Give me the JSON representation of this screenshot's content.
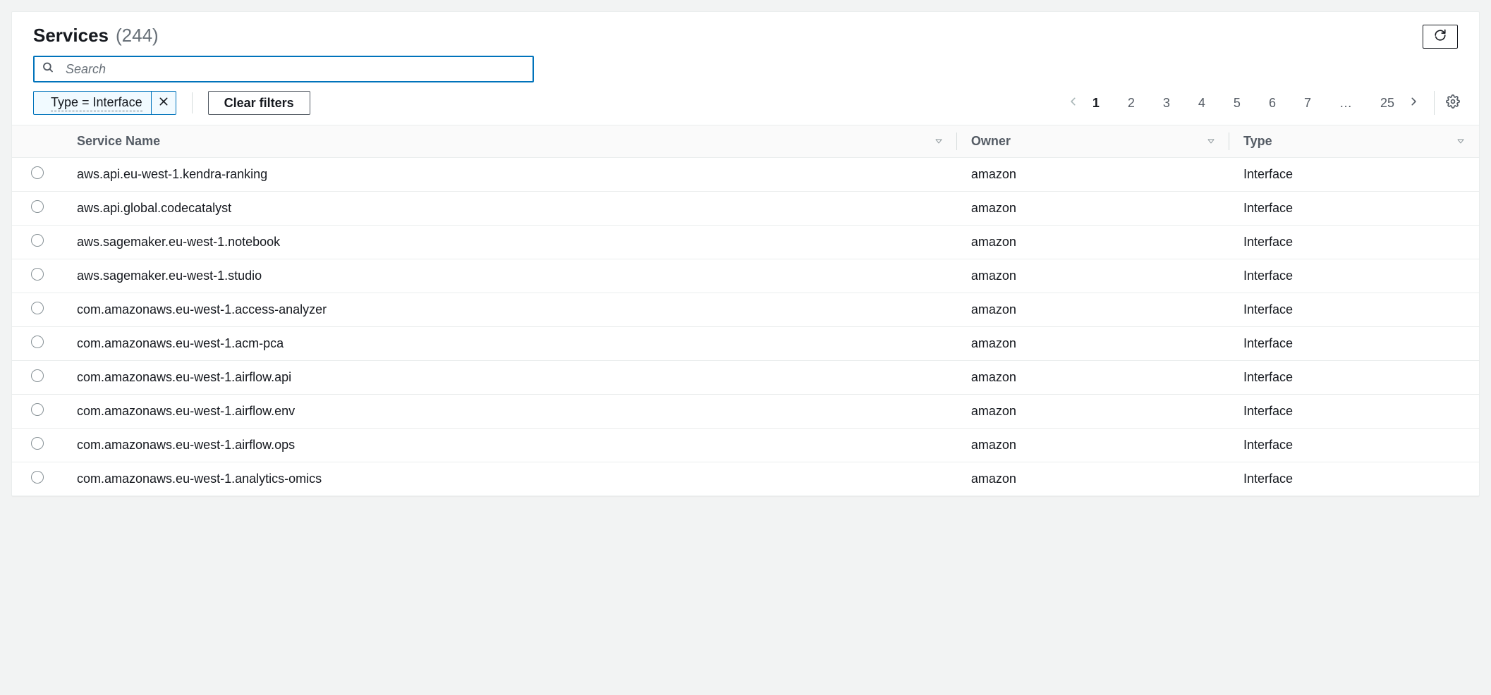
{
  "header": {
    "title": "Services",
    "count": "(244)"
  },
  "search": {
    "placeholder": "Search",
    "value": ""
  },
  "filters": {
    "chip_label": "Type = Interface",
    "clear_label": "Clear filters"
  },
  "pagination": {
    "pages": [
      "1",
      "2",
      "3",
      "4",
      "5",
      "6",
      "7"
    ],
    "ellipsis": "…",
    "last": "25",
    "current": "1"
  },
  "table": {
    "columns": {
      "service_name": "Service Name",
      "owner": "Owner",
      "type": "Type"
    },
    "rows": [
      {
        "name": "aws.api.eu-west-1.kendra-ranking",
        "owner": "amazon",
        "type": "Interface"
      },
      {
        "name": "aws.api.global.codecatalyst",
        "owner": "amazon",
        "type": "Interface"
      },
      {
        "name": "aws.sagemaker.eu-west-1.notebook",
        "owner": "amazon",
        "type": "Interface"
      },
      {
        "name": "aws.sagemaker.eu-west-1.studio",
        "owner": "amazon",
        "type": "Interface"
      },
      {
        "name": "com.amazonaws.eu-west-1.access-analyzer",
        "owner": "amazon",
        "type": "Interface"
      },
      {
        "name": "com.amazonaws.eu-west-1.acm-pca",
        "owner": "amazon",
        "type": "Interface"
      },
      {
        "name": "com.amazonaws.eu-west-1.airflow.api",
        "owner": "amazon",
        "type": "Interface"
      },
      {
        "name": "com.amazonaws.eu-west-1.airflow.env",
        "owner": "amazon",
        "type": "Interface"
      },
      {
        "name": "com.amazonaws.eu-west-1.airflow.ops",
        "owner": "amazon",
        "type": "Interface"
      },
      {
        "name": "com.amazonaws.eu-west-1.analytics-omics",
        "owner": "amazon",
        "type": "Interface"
      }
    ]
  }
}
